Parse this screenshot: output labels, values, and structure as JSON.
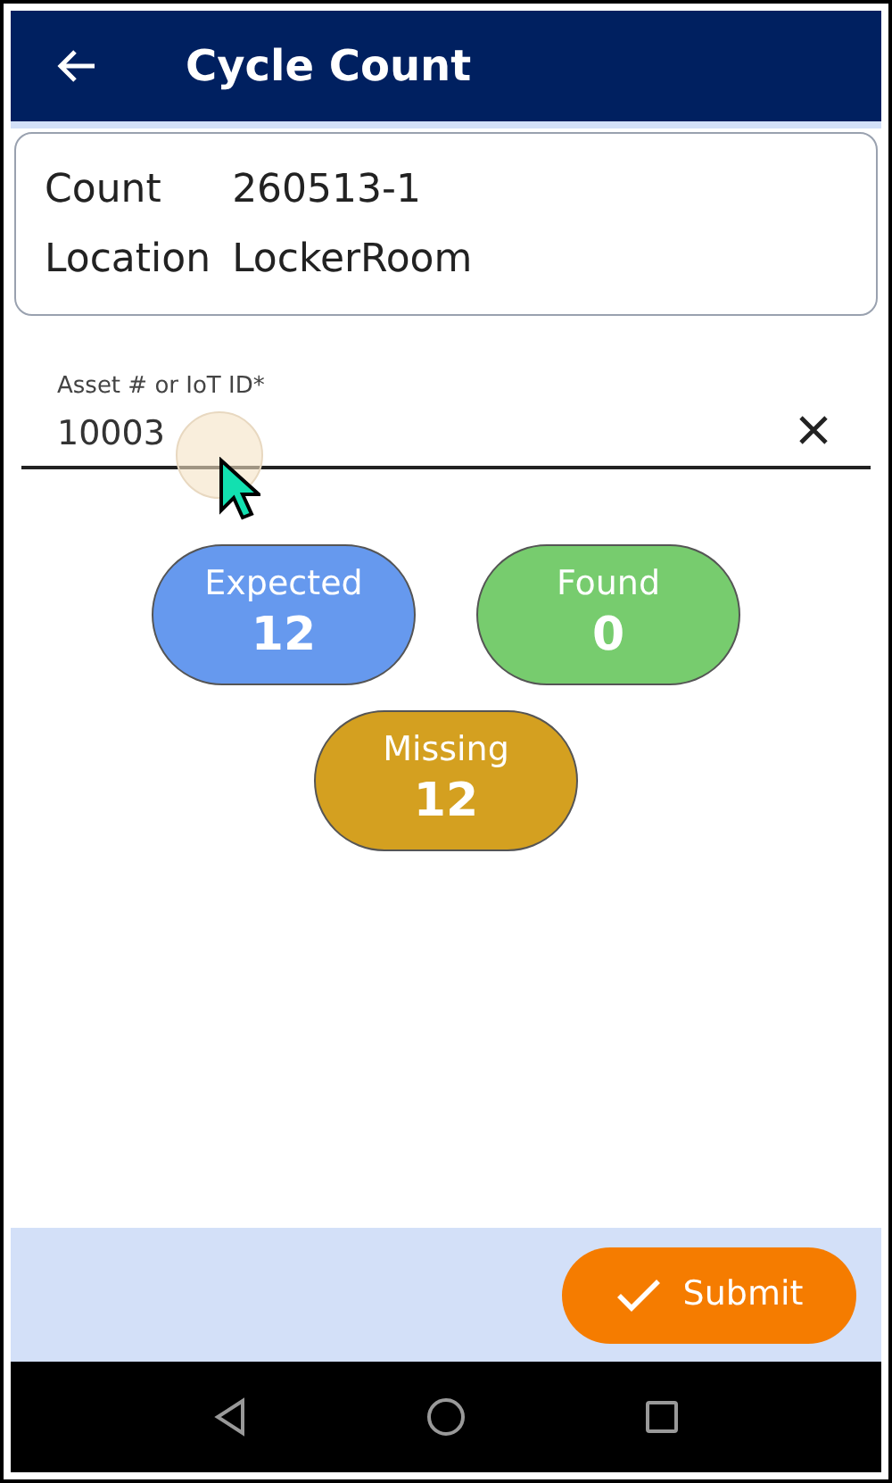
{
  "header": {
    "title": "Cycle Count"
  },
  "details": [
    {
      "label": "Count",
      "value": "260513-1"
    },
    {
      "label": "Location",
      "value": "LockerRoom"
    }
  ],
  "asset_field": {
    "label": "Asset # or IoT ID*",
    "value": "10003"
  },
  "counters": [
    {
      "label": "Expected",
      "value": "12",
      "color": "#6699ee"
    },
    {
      "label": "Found",
      "value": "0",
      "color": "#77cc6e"
    },
    {
      "label": "Missing",
      "value": "12",
      "color": "#d4a020"
    }
  ],
  "footer": {
    "submit_button": "Submit"
  }
}
